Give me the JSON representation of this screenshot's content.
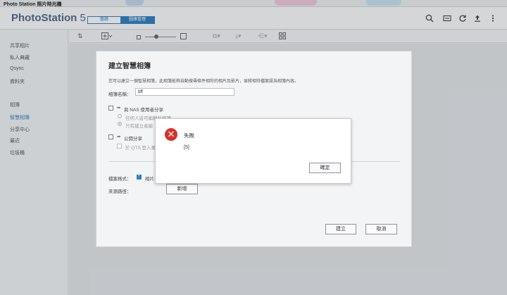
{
  "window": {
    "title": "Photo Station 照片時光機"
  },
  "header": {
    "logo_prefix": "PhotoStation",
    "logo_version": "5",
    "tabs": [
      {
        "label": "藝廊"
      },
      {
        "label": "圖庫管理"
      }
    ],
    "icons": [
      "search-icon",
      "slideshow-icon",
      "refresh-icon",
      "upload-icon",
      "more-icon"
    ]
  },
  "sidebar": {
    "items": [
      {
        "label": "共享相片"
      },
      {
        "label": "私人典藏"
      },
      {
        "label": "Qsync"
      },
      {
        "label": "資料夾"
      },
      {
        "label": "相簿"
      },
      {
        "label": "智慧相簿"
      },
      {
        "label": "分享中心"
      },
      {
        "label": "最近"
      },
      {
        "label": "垃圾桶"
      }
    ]
  },
  "toolbar": {
    "icons": [
      "sort-icon",
      "add-icon",
      "zoom-small-icon",
      "zoom-large-icon",
      "copy-icon",
      "download-icon",
      "share-icon",
      "grid-icon"
    ]
  },
  "smart_album_dialog": {
    "title": "建立智慧相簿",
    "description": "您可以建立一個智慧相簿，此相簿能夠自動搜尋條件相符的相片及影片，並將相符檔案設為相簿內容。",
    "name_label": "相簿名稱：",
    "name_value": "tiff",
    "share_nas_label": "與 NAS 使用者分享",
    "share_nas_opt1": "任何人皆可編輯此相簿",
    "share_nas_opt2": "只有建立者編",
    "public_share_label": "公開分享",
    "public_share_opt": "於 QTS 登入畫",
    "file_format_label": "檔案格式：",
    "file_format_photo": "相片",
    "source_path_label": "來源路徑：",
    "add_button": "新增",
    "create_button": "建立",
    "cancel_button": "取消"
  },
  "error_dialog": {
    "title": "失敗",
    "message": "[5]",
    "ok_button": "確定"
  },
  "colors": {
    "accent": "#2f7fc2",
    "error": "#d6312b"
  }
}
